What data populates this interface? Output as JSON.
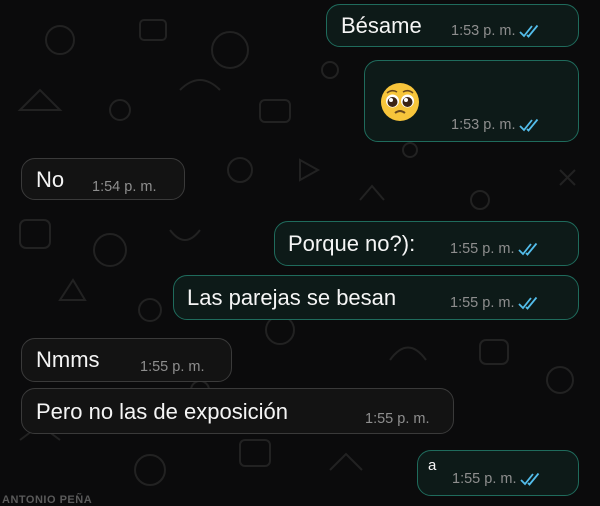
{
  "chat": {
    "messages": [
      {
        "direction": "outgoing",
        "text": "Bésame",
        "time": "1:53 p. m.",
        "status": "read"
      },
      {
        "direction": "outgoing",
        "text": "",
        "emoji": "pleading-face-emoji",
        "time": "1:53 p. m.",
        "status": "read"
      },
      {
        "direction": "incoming",
        "text": "No",
        "time": "1:54 p. m."
      },
      {
        "direction": "outgoing",
        "text": "Porque no?):",
        "time": "1:55 p. m.",
        "status": "read"
      },
      {
        "direction": "outgoing",
        "text": "Las parejas se besan",
        "time": "1:55 p. m.",
        "status": "read"
      },
      {
        "direction": "incoming",
        "text": "Nmms",
        "time": "1:55 p. m."
      },
      {
        "direction": "incoming",
        "text": "Pero no las de exposición",
        "time": "1:55 p. m."
      },
      {
        "direction": "outgoing",
        "text": "a",
        "time": "1:55 p. m.",
        "status": "read"
      }
    ]
  },
  "watermark": "ANTONIO PEÑA",
  "colors": {
    "background": "#0b0b0c",
    "outgoing_border": "#1f6b5c",
    "incoming_border": "#3a3a3a",
    "read_ticks": "#53bdeb",
    "timestamp": "#8e8e8e"
  }
}
